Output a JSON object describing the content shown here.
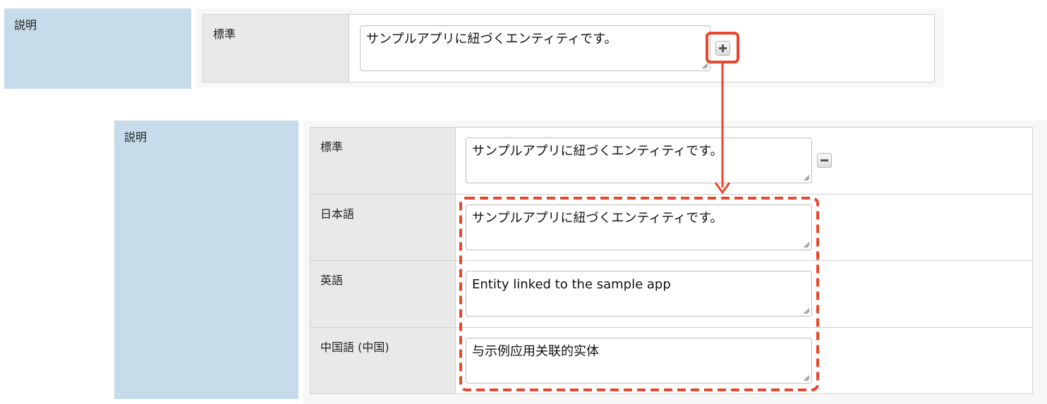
{
  "top": {
    "field_label": "説明",
    "rows": [
      {
        "language": "標準",
        "value": "サンプルアプリに紐づくエンティティです。"
      }
    ],
    "add_icon": "plus-icon"
  },
  "bottom": {
    "field_label": "説明",
    "rows": [
      {
        "language": "標準",
        "value": "サンプルアプリに紐づくエンティティです。"
      },
      {
        "language": "日本語",
        "value": "サンプルアプリに紐づくエンティティです。"
      },
      {
        "language": "英語",
        "value": "Entity linked to the sample app"
      },
      {
        "language": "中国語 (中国)",
        "value": "与示例应用关联的实体"
      }
    ],
    "remove_icon": "minus-icon"
  },
  "colors": {
    "label_bg": "#c6dcea",
    "lang_bg": "#e9e9e9",
    "highlight": "#e8472e"
  }
}
